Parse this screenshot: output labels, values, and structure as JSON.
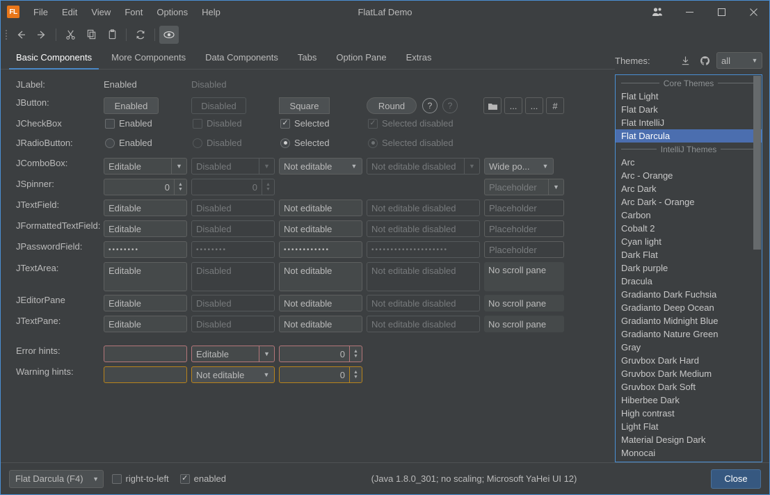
{
  "window": {
    "title": "FlatLaf Demo",
    "logo_text": "FL",
    "controls": {
      "people": "people-icon",
      "minimize": "—",
      "maximize": "□",
      "close": "✕"
    }
  },
  "menubar": {
    "items": [
      "File",
      "Edit",
      "View",
      "Font",
      "Options",
      "Help"
    ]
  },
  "toolbar": {
    "items": [
      {
        "name": "back-button",
        "glyph": "←"
      },
      {
        "name": "forward-button",
        "glyph": "→"
      },
      {
        "name": "cut-button",
        "glyph": "✂"
      },
      {
        "name": "copy-button",
        "glyph": "❐"
      },
      {
        "name": "paste-button",
        "glyph": "📋"
      },
      {
        "name": "refresh-button",
        "glyph": "⟳"
      },
      {
        "name": "preview-button",
        "glyph": "◉"
      }
    ]
  },
  "tabs": {
    "items": [
      "Basic Components",
      "More Components",
      "Data Components",
      "Tabs",
      "Option Pane",
      "Extras"
    ],
    "active": "Basic Components"
  },
  "form": {
    "labels": {
      "jlabel": "JLabel:",
      "jbutton": "JButton:",
      "jcheckbox": "JCheckBox",
      "jradiobutton": "JRadioButton:",
      "jcombobox": "JComboBox:",
      "jspinner": "JSpinner:",
      "jtextfield": "JTextField:",
      "jformattedtextfield": "JFormattedTextField:",
      "jpasswordfield": "JPasswordField:",
      "jtextarea": "JTextArea:",
      "jeditorpane": "JEditorPane",
      "jtextpane": "JTextPane:",
      "error_hints": "Error hints:",
      "warning_hints": "Warning hints:"
    },
    "jlabel": {
      "enabled": "Enabled",
      "disabled": "Disabled"
    },
    "jbutton": {
      "enabled": "Enabled",
      "disabled": "Disabled",
      "square": "Square",
      "round": "Round",
      "help": "?",
      "help_disabled": "?",
      "folder_icon": "folder-icon",
      "ellipsis1": "...",
      "ellipsis2": "...",
      "hash": "#"
    },
    "jcheckbox": {
      "enabled": "Enabled",
      "disabled": "Disabled",
      "selected": "Selected",
      "selected_disabled": "Selected disabled",
      "check_glyph": "✓"
    },
    "jradiobutton": {
      "enabled": "Enabled",
      "disabled": "Disabled",
      "selected": "Selected",
      "selected_disabled": "Selected disabled"
    },
    "jcombobox": {
      "editable": "Editable",
      "disabled": "Disabled",
      "not_editable": "Not editable",
      "not_editable_disabled": "Not editable disabled",
      "wide_popup": "Wide po...",
      "placeholder": "Placeholder"
    },
    "jspinner": {
      "value1": "0",
      "value2": "0"
    },
    "jtextfield": {
      "editable": "Editable",
      "disabled": "Disabled",
      "not_editable": "Not editable",
      "not_editable_disabled": "Not editable disabled",
      "placeholder": "Placeholder"
    },
    "jformattedtextfield": {
      "editable": "Editable",
      "disabled": "Disabled",
      "not_editable": "Not editable",
      "not_editable_disabled": "Not editable disabled",
      "placeholder": "Placeholder"
    },
    "jpasswordfield": {
      "editable": "••••••••",
      "disabled": "••••••••",
      "not_editable": "••••••••••••",
      "not_editable_disabled": "••••••••••••••••••••",
      "placeholder": "Placeholder"
    },
    "jtextarea": {
      "editable": "Editable",
      "disabled": "Disabled",
      "not_editable": "Not editable",
      "not_editable_disabled": "Not editable disabled",
      "no_scroll_pane": "No scroll pane"
    },
    "jeditorpane": {
      "editable": "Editable",
      "disabled": "Disabled",
      "not_editable": "Not editable",
      "not_editable_disabled": "Not editable disabled",
      "no_scroll_pane": "No scroll pane"
    },
    "jtextpane": {
      "editable": "Editable",
      "disabled": "Disabled",
      "not_editable": "Not editable",
      "not_editable_disabled": "Not editable disabled",
      "no_scroll_pane": "No scroll pane"
    },
    "error_hints": {
      "text_value": "",
      "combo_value": "Editable",
      "spinner_value": "0"
    },
    "warning_hints": {
      "text_value": "",
      "combo_value": "Not editable",
      "spinner_value": "0"
    }
  },
  "themes": {
    "label": "Themes:",
    "download_icon": "download-icon",
    "github_icon": "github-icon",
    "filter_value": "all",
    "selected": "Flat Darcula",
    "groups": [
      {
        "title": "Core Themes",
        "items": [
          "Flat Light",
          "Flat Dark",
          "Flat IntelliJ",
          "Flat Darcula"
        ]
      },
      {
        "title": "IntelliJ Themes",
        "items": [
          "Arc",
          "Arc - Orange",
          "Arc Dark",
          "Arc Dark - Orange",
          "Carbon",
          "Cobalt 2",
          "Cyan light",
          "Dark Flat",
          "Dark purple",
          "Dracula",
          "Gradianto Dark Fuchsia",
          "Gradianto Deep Ocean",
          "Gradianto Midnight Blue",
          "Gradianto Nature Green",
          "Gray",
          "Gruvbox Dark Hard",
          "Gruvbox Dark Medium",
          "Gruvbox Dark Soft",
          "Hiberbee Dark",
          "High contrast",
          "Light Flat",
          "Material Design Dark",
          "Monocai"
        ]
      }
    ]
  },
  "statusbar": {
    "theme_select": "Flat Darcula (F4)",
    "rtl_label": "right-to-left",
    "enabled_label": "enabled",
    "info": "(Java 1.8.0_301; no scaling; Microsoft YaHei UI 12)",
    "close_label": "Close"
  },
  "colors": {
    "background": "#3c3f41",
    "accent": "#4a88c7",
    "selection": "#4b6eaf",
    "logo": "#e8761a",
    "error": "#b4767a",
    "warning": "#b9841b",
    "button_primary": "#365880"
  }
}
